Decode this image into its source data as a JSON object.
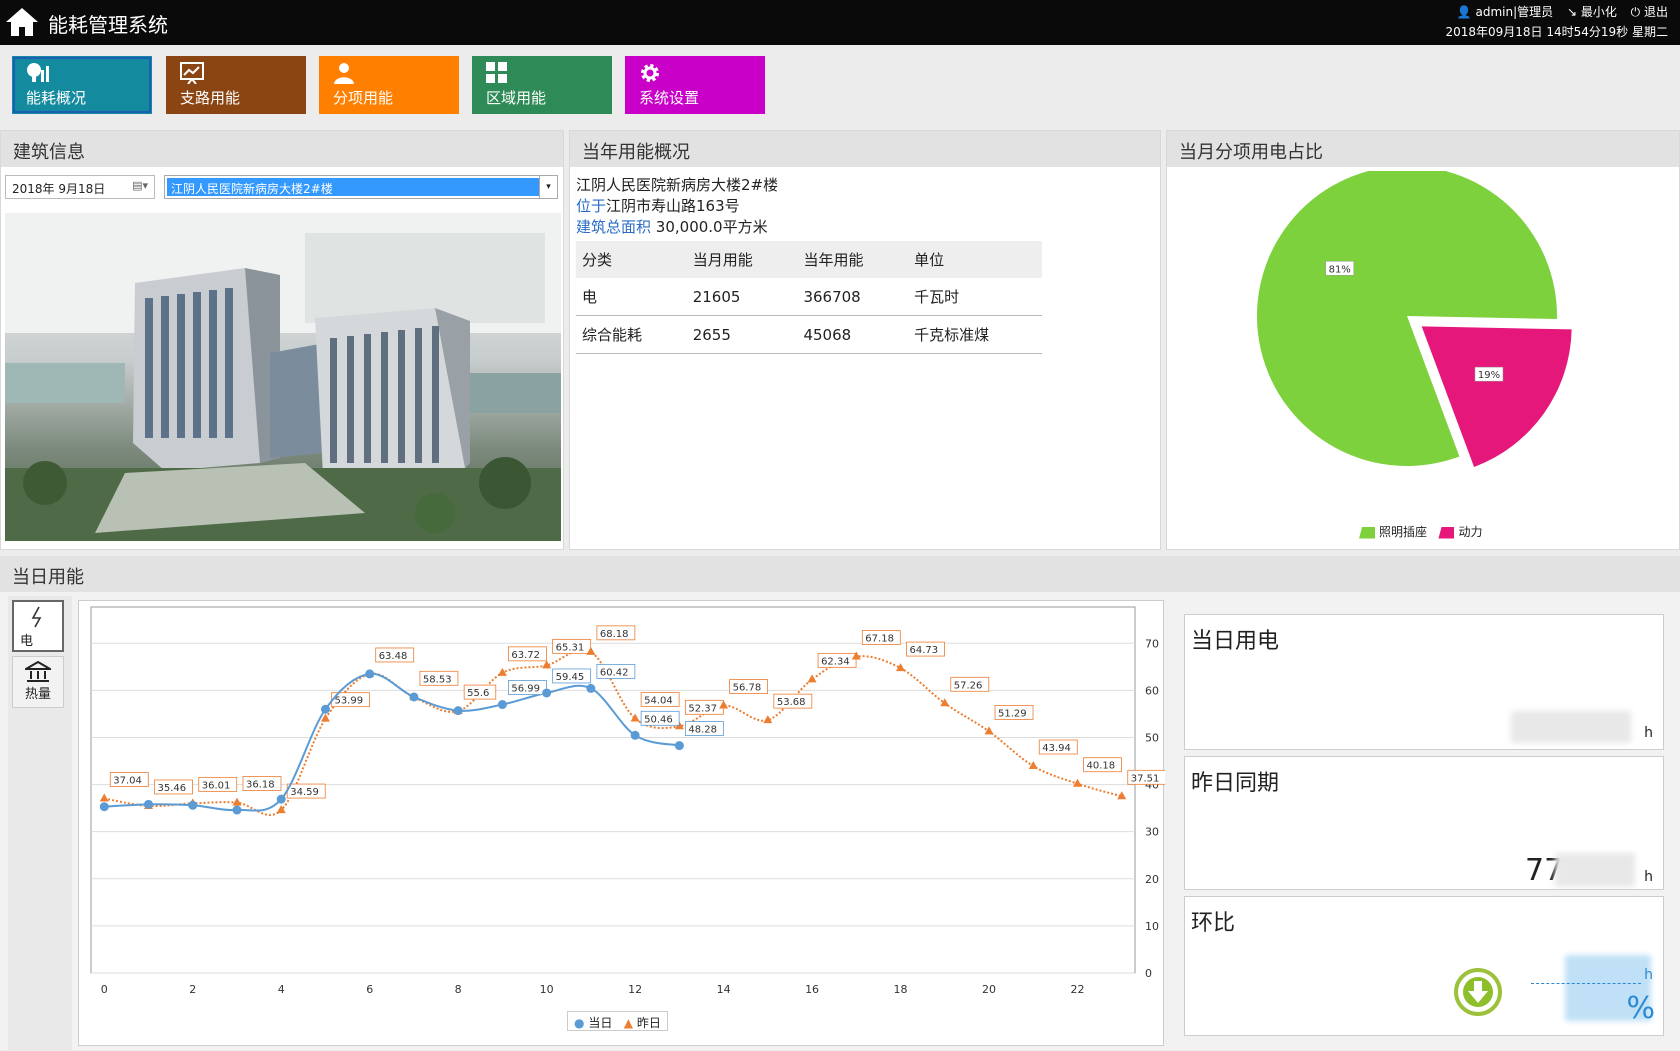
{
  "header": {
    "title": "能耗管理系统",
    "user": "admin|管理员",
    "minimize": "最小化",
    "logout": "退出",
    "datetime": "2018年09月18日 14时54分19秒 星期二"
  },
  "nav": [
    {
      "label": "能耗概况",
      "color": "#138a9e",
      "icon": "energy-overview-icon"
    },
    {
      "label": "支路用能",
      "color": "#8b4513",
      "icon": "branch-chart-icon"
    },
    {
      "label": "分项用能",
      "color": "#ff7f00",
      "icon": "person-icon"
    },
    {
      "label": "区域用能",
      "color": "#2e8b57",
      "icon": "grid-icon"
    },
    {
      "label": "系统设置",
      "color": "#c800c8",
      "icon": "gear-icon"
    }
  ],
  "building_panel": {
    "title": "建筑信息",
    "date": "2018年  9月18日",
    "selected_building": "江阴人民医院新病房大楼2#楼"
  },
  "year_panel": {
    "title": "当年用能概况",
    "building_name": "江阴人民医院新病房大楼2#楼",
    "location_label": "位于",
    "location_value": "江阴市寿山路163号",
    "area_label": "建筑总面积",
    "area_value": "30,000.0平方米",
    "table": {
      "headers": [
        "分类",
        "当月用能",
        "当年用能",
        "单位"
      ],
      "rows": [
        [
          "电",
          "21605",
          "366708",
          "千瓦时"
        ],
        [
          "综合能耗",
          "2655",
          "45068",
          "千克标准煤"
        ]
      ]
    }
  },
  "pie_panel": {
    "title": "当月分项用电占比",
    "chart_data": {
      "type": "pie",
      "slices": [
        {
          "name": "照明插座",
          "value": 81,
          "label": "81%",
          "color": "#7dd13d"
        },
        {
          "name": "动力",
          "value": 19,
          "label": "19%",
          "color": "#e5177b"
        }
      ]
    }
  },
  "day_panel": {
    "title": "当日用能",
    "tabs": [
      {
        "label": "电",
        "icon": "lightning-icon"
      },
      {
        "label": "热量",
        "icon": "heat-icon"
      }
    ],
    "chart_data": {
      "type": "line",
      "x_ticks": [
        0,
        2,
        4,
        6,
        8,
        10,
        12,
        14,
        16,
        18,
        20,
        22
      ],
      "y_ticks": [
        0,
        10,
        20,
        30,
        40,
        50,
        60,
        70
      ],
      "xlim": [
        -0.3,
        23.3
      ],
      "ylim": [
        0,
        76
      ],
      "series": [
        {
          "name": "当日",
          "color": "#5b9bd5",
          "x": [
            0,
            1,
            2,
            3,
            4,
            5,
            6,
            7,
            8,
            9,
            10,
            11,
            12,
            13
          ],
          "values": [
            35.3,
            35.8,
            35.6,
            34.6,
            36.9,
            56.0,
            63.5,
            58.6,
            55.7,
            56.99,
            59.45,
            60.42,
            50.46,
            48.28
          ],
          "labels": [
            "",
            "",
            "",
            "",
            "",
            "",
            "",
            "",
            "",
            "56.99",
            "59.45",
            "60.42",
            "50.46",
            "48.28"
          ]
        },
        {
          "name": "昨日",
          "color": "#ed7d31",
          "x": [
            0,
            1,
            2,
            3,
            4,
            5,
            6,
            7,
            8,
            9,
            10,
            11,
            12,
            13,
            14,
            15,
            16,
            17,
            18,
            19,
            20,
            21,
            22,
            23
          ],
          "values": [
            37.04,
            35.46,
            36.01,
            36.18,
            34.59,
            53.99,
            63.48,
            58.53,
            55.6,
            63.72,
            65.31,
            68.18,
            54.04,
            52.37,
            56.78,
            53.68,
            62.34,
            67.18,
            64.73,
            57.26,
            51.29,
            43.94,
            40.18,
            37.51
          ],
          "labels": [
            "37.04",
            "35.46",
            "36.01",
            "36.18",
            "34.59",
            "53.99",
            "63.48",
            "58.53",
            "55.6",
            "63.72",
            "65.31",
            "68.18",
            "54.04",
            "52.37",
            "56.78",
            "53.68",
            "62.34",
            "67.18",
            "64.73",
            "57.26",
            "51.29",
            "43.94",
            "40.18",
            "37.51"
          ]
        }
      ]
    },
    "cards": [
      {
        "title": "当日用电",
        "unit": "h"
      },
      {
        "title": "昨日同期",
        "value_partial": "77",
        "unit": "h"
      },
      {
        "title": "环比",
        "unit": "h",
        "percent_sign": "%"
      }
    ]
  }
}
